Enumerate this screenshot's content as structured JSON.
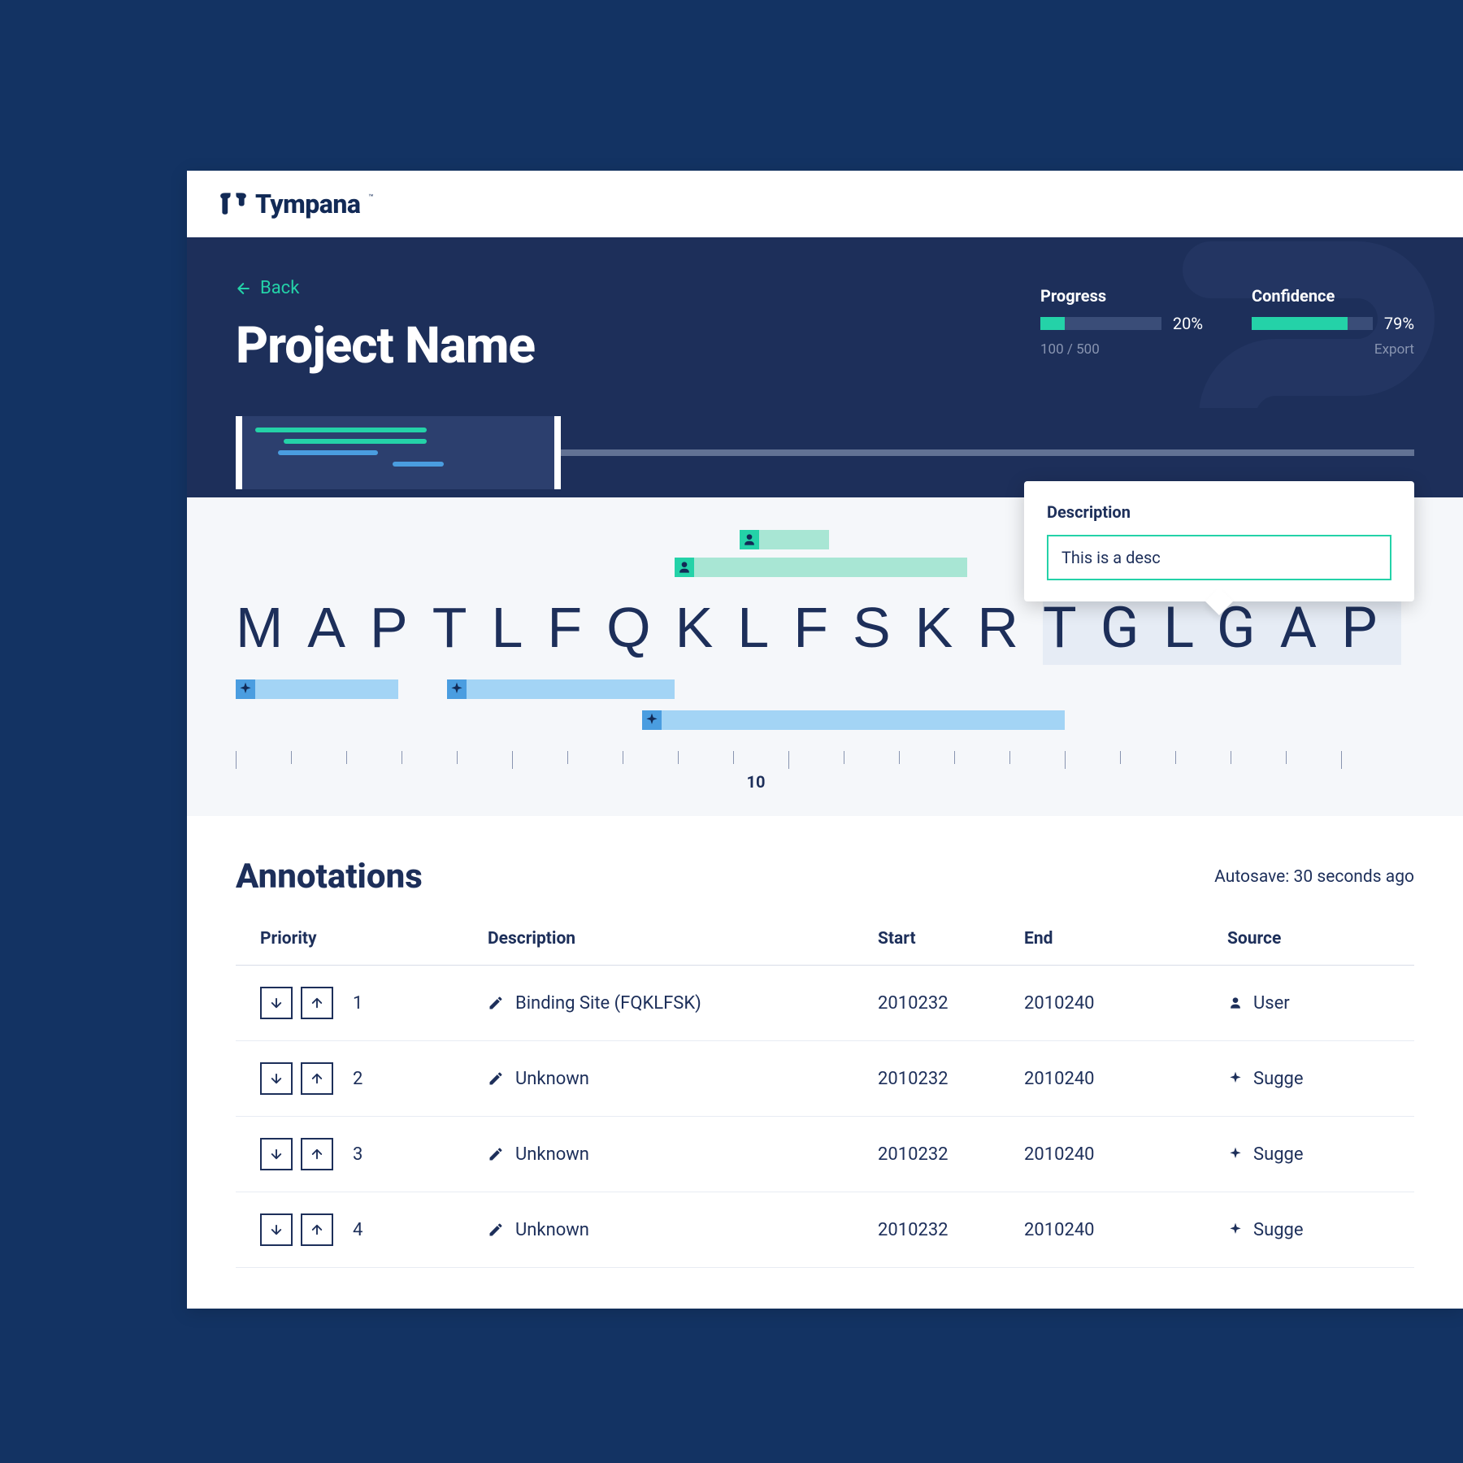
{
  "brand": {
    "name": "Tympana"
  },
  "header": {
    "back_label": "Back",
    "title": "Project Name",
    "progress": {
      "label": "Progress",
      "percent": "20%",
      "fill_pct": 20,
      "sub": "100 / 500"
    },
    "confidence": {
      "label": "Confidence",
      "percent": "79%",
      "fill_pct": 79,
      "export_label": "Export"
    }
  },
  "sequence": {
    "letters": "MAPTLFQKLFSKRTGLGAP",
    "highlight_start_idx": 13,
    "ruler_label": "10",
    "popover": {
      "title": "Description",
      "value": "This is a desc"
    }
  },
  "annotations": {
    "title": "Annotations",
    "autosave": "Autosave: 30 seconds ago",
    "columns": {
      "priority": "Priority",
      "description": "Description",
      "start": "Start",
      "end": "End",
      "source": "Source"
    },
    "rows": [
      {
        "priority": "1",
        "description": "Binding Site (FQKLFSK)",
        "start": "2010232",
        "end": "2010240",
        "source_icon": "user",
        "source": "User"
      },
      {
        "priority": "2",
        "description": "Unknown",
        "start": "2010232",
        "end": "2010240",
        "source_icon": "sparkle",
        "source": "Sugge"
      },
      {
        "priority": "3",
        "description": "Unknown",
        "start": "2010232",
        "end": "2010240",
        "source_icon": "sparkle",
        "source": "Sugge"
      },
      {
        "priority": "4",
        "description": "Unknown",
        "start": "2010232",
        "end": "2010240",
        "source_icon": "sparkle",
        "source": "Sugge"
      }
    ]
  }
}
